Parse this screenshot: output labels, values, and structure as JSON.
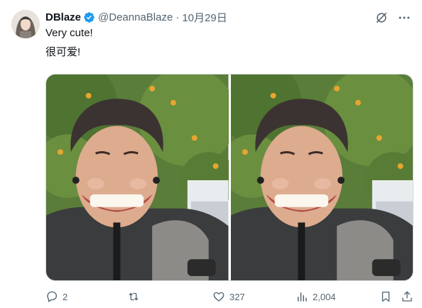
{
  "post": {
    "display_name": "DBlaze",
    "handle": "@DeannaBlaze",
    "separator": "·",
    "timestamp": "10月29日",
    "text_line_1": "Very cute!",
    "text_line_2": "很可爱!",
    "verified_badge": true
  },
  "media": {
    "count": 2,
    "items": [
      "photo-smiling-person-1",
      "photo-smiling-person-2"
    ]
  },
  "actions": {
    "replies": "2",
    "retweets": "",
    "likes": "327",
    "views": "2,004"
  },
  "icons": {
    "top": [
      "grok-icon",
      "more-icon"
    ],
    "actions": [
      "reply-icon",
      "retweet-icon",
      "like-icon",
      "views-icon",
      "bookmark-icon",
      "share-icon"
    ]
  },
  "colors": {
    "text": "#0f1419",
    "secondary": "#536471",
    "verified": "#1d9bf0"
  }
}
